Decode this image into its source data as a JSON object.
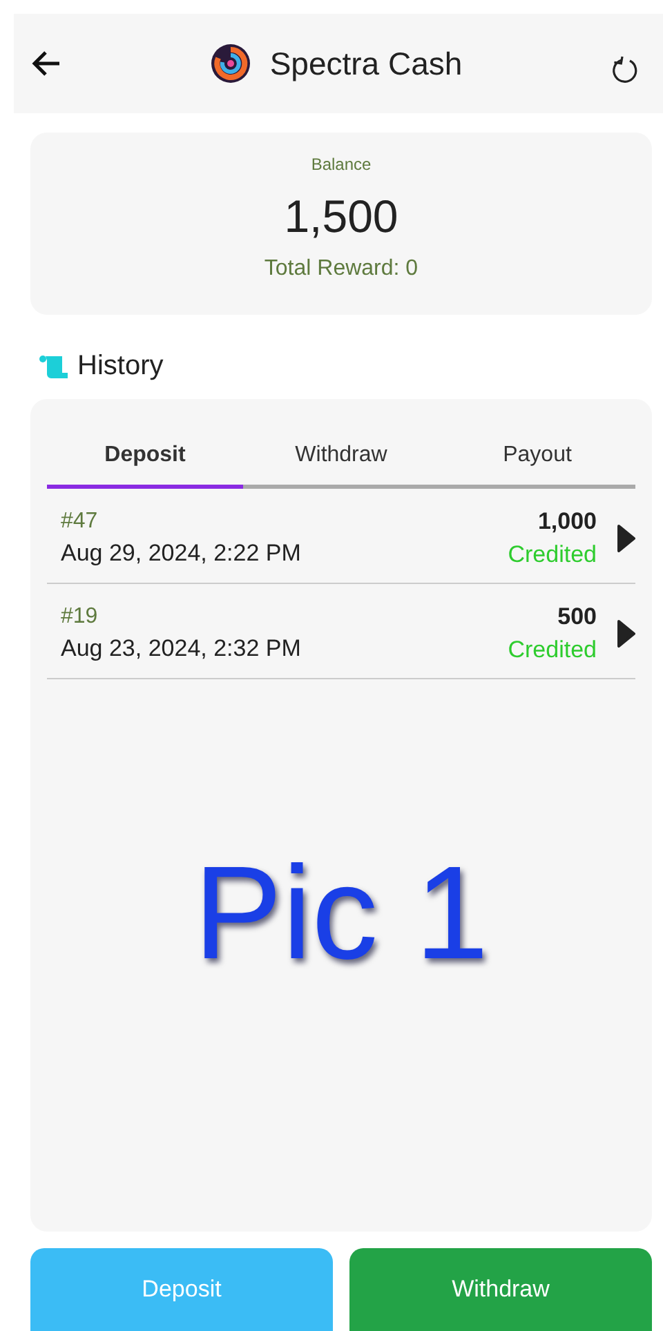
{
  "header": {
    "title": "Spectra Cash"
  },
  "balance": {
    "label": "Balance",
    "amount": "1,500",
    "reward": "Total Reward: 0"
  },
  "history": {
    "title": "History"
  },
  "tabs": [
    {
      "label": "Deposit",
      "selected": true
    },
    {
      "label": "Withdraw",
      "selected": false
    },
    {
      "label": "Payout",
      "selected": false
    }
  ],
  "transactions": [
    {
      "id": "#47",
      "date": "Aug 29, 2024, 2:22 PM",
      "amount": "1,000",
      "status": "Credited"
    },
    {
      "id": "#19",
      "date": "Aug 23, 2024, 2:32 PM",
      "amount": "500",
      "status": "Credited"
    }
  ],
  "overlay_label": "Pic 1",
  "buttons": [
    {
      "label": "Deposit",
      "kind": "deposit"
    },
    {
      "label": "Withdraw",
      "kind": "withdraw"
    }
  ]
}
